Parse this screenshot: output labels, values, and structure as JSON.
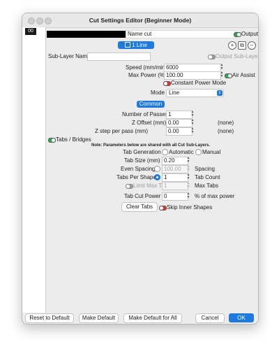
{
  "window": {
    "title": "Cut Settings Editor (Beginner Mode)"
  },
  "sidebar": {
    "layer": "00"
  },
  "header": {
    "name_label": "Name cut",
    "output_label": "Output",
    "sub_layer_button": "1 Line",
    "sub_layer_name_label": "Sub-Layer Name",
    "sub_layer_name_value": "",
    "output_sub_layer_label": "Output Sub-Layer"
  },
  "settings": {
    "speed_label": "Speed (mm/min)",
    "speed_value": "6000",
    "max_power_label": "Max Power (%)",
    "max_power_value": "100.00",
    "air_assist_label": "Air Assist",
    "constant_power_label": "Constant Power Mode",
    "mode_label": "Mode",
    "mode_value": "Line"
  },
  "common": {
    "tab_label": "Common",
    "passes_label": "Number of Passes",
    "passes_value": "1",
    "z_offset_label": "Z Offset (mm)",
    "z_offset_value": "0.00",
    "z_offset_suffix": "(none)",
    "z_step_label": "Z step per pass (mm)",
    "z_step_value": "0.00",
    "z_step_suffix": "(none)"
  },
  "tabs": {
    "section_label": "Tabs / Bridges",
    "note": "Note: Parameters below are shared with all Cut Sub-Layers.",
    "generation_label": "Tab Generation",
    "automatic_label": "Automatic",
    "manual_label": "Manual",
    "size_label": "Tab Size (mm)",
    "size_value": "0.20",
    "even_spacing_label": "Even Spacing",
    "even_spacing_value": "100.00",
    "spacing_suffix": "Spacing",
    "per_shape_label": "Tabs Per Shape",
    "per_shape_value": "1",
    "tab_count_suffix": "Tab Count",
    "limit_label": "Limit Max Tabs",
    "limit_value": "1",
    "max_tabs_suffix": "Max Tabs",
    "cut_power_label": "Tab Cut Power",
    "cut_power_value": "0",
    "cut_power_suffix": "% of max power",
    "clear_button": "Clear Tabs",
    "skip_inner_label": "Skip Inner Shapes"
  },
  "footer": {
    "reset_button": "Reset to Default",
    "make_default_button": "Make Default",
    "make_default_all_button": "Make Default for All",
    "cancel_button": "Cancel",
    "ok_button": "OK"
  },
  "colors": {
    "accent": "#1f7ae0",
    "toggle_on": "#2ea44f",
    "toggle_red": "#dd3333"
  }
}
